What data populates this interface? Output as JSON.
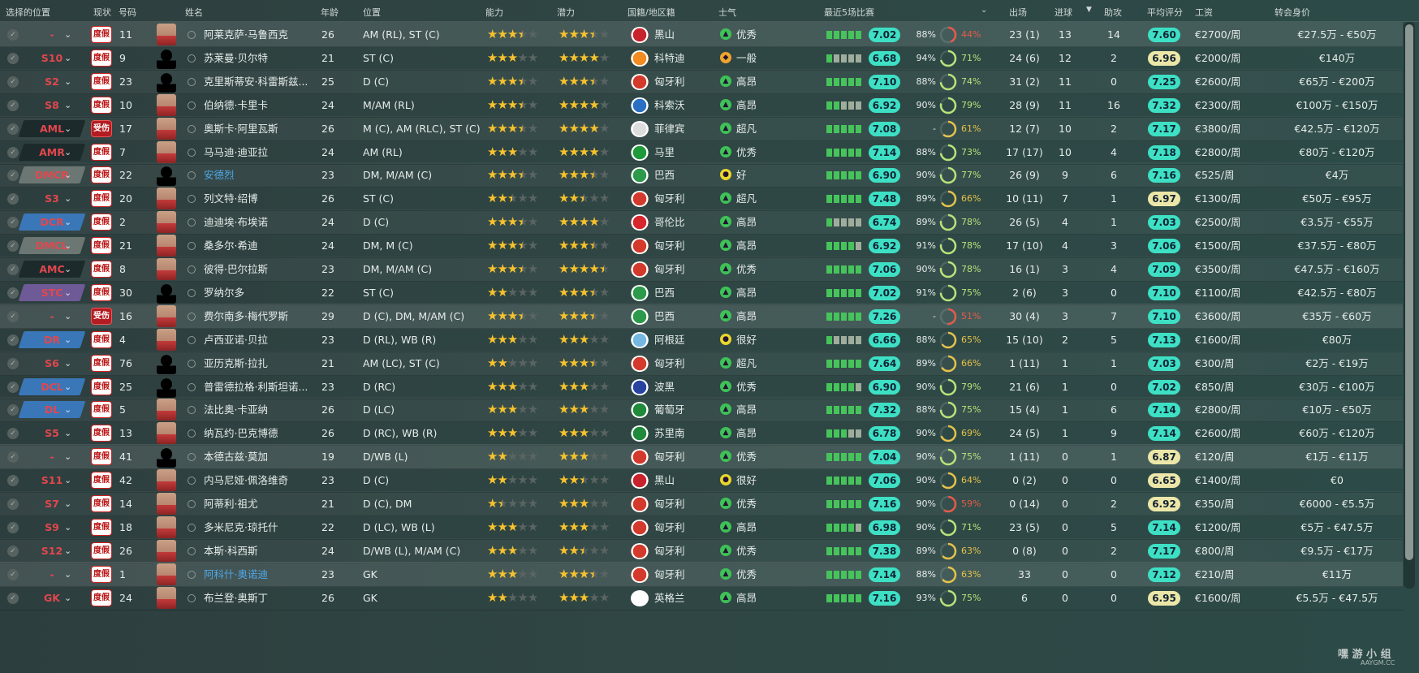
{
  "headers": {
    "select_pos": "选择的位置",
    "status": "现状",
    "number": "号码",
    "name": "姓名",
    "age": "年龄",
    "position": "位置",
    "ability": "能力",
    "potential": "潜力",
    "nationality": "国籍/地区籍",
    "morale": "士气",
    "last5": "最近5场比赛",
    "apps": "出场",
    "goals": "进球",
    "assists": "助攻",
    "avg_rating": "平均评分",
    "wage": "工资",
    "value": "转会身价"
  },
  "colors": {
    "rating_good": "#3ee0c4",
    "rating_ok": "#ece7a8",
    "pos_red": "#e2474d",
    "bar_green": "#46c35b",
    "bar_off": "#a0ad9c",
    "link_blue": "#4ea8e8"
  },
  "players": [
    {
      "pos": "-",
      "pos_style": "none",
      "status": "度假",
      "num": "11",
      "name": "阿莱克萨·马鲁西克",
      "face": "photo",
      "age": "26",
      "position": "AM (RL), ST (C)",
      "ability": 3.5,
      "potential": 3.5,
      "flag": "#c8232c",
      "nation": "黑山",
      "morale": "优秀",
      "mood": "up",
      "form": [
        1,
        1,
        1,
        1,
        1
      ],
      "form_rating": "7.02",
      "fitness": "88%",
      "cond": "44%",
      "cond_val": 0.44,
      "apps": "23 (1)",
      "goals": "13",
      "assists": "14",
      "avg": "7.60",
      "avg_style": "good",
      "wage": "€2700/周",
      "value": "€27.5万 - €50万",
      "row": "hl"
    },
    {
      "pos": "S10",
      "pos_style": "none",
      "status": "度假",
      "num": "9",
      "name": "苏莱曼·贝尔特",
      "face": "sil",
      "age": "21",
      "position": "ST (C)",
      "ability": 3,
      "potential": 4,
      "flag": "#f28b20",
      "nation": "科特迪",
      "morale": "一般",
      "mood": "mid",
      "form": [
        1,
        0,
        0,
        0,
        0
      ],
      "form_rating": "6.68",
      "fitness": "94%",
      "cond": "71%",
      "cond_val": 0.71,
      "apps": "24 (6)",
      "goals": "12",
      "assists": "2",
      "avg": "6.96",
      "avg_style": "ok",
      "wage": "€2000/周",
      "value": "€140万",
      "row": ""
    },
    {
      "pos": "S2",
      "pos_style": "none",
      "status": "度假",
      "num": "23",
      "name": "克里斯蒂安·科雷斯兹...",
      "face": "sil",
      "age": "25",
      "position": "D (C)",
      "ability": 3.5,
      "potential": 3.5,
      "flag": "#d33a2c",
      "nation": "匈牙利",
      "morale": "高昂",
      "mood": "up",
      "form": [
        1,
        1,
        1,
        1,
        1
      ],
      "form_rating": "7.10",
      "fitness": "88%",
      "cond": "74%",
      "cond_val": 0.74,
      "apps": "31 (2)",
      "goals": "11",
      "assists": "0",
      "avg": "7.25",
      "avg_style": "good",
      "wage": "€2600/周",
      "value": "€65万 - €200万",
      "row": "alt"
    },
    {
      "pos": "S8",
      "pos_style": "none",
      "status": "度假",
      "num": "10",
      "name": "伯纳德·卡里卡",
      "face": "photo",
      "age": "24",
      "position": "M/AM (RL)",
      "ability": 3.5,
      "potential": 4,
      "flag": "#2a6fc4",
      "nation": "科索沃",
      "morale": "高昂",
      "mood": "up",
      "form": [
        1,
        1,
        0,
        0,
        0
      ],
      "form_rating": "6.92",
      "fitness": "90%",
      "cond": "79%",
      "cond_val": 0.79,
      "apps": "28 (9)",
      "goals": "11",
      "assists": "16",
      "avg": "7.32",
      "avg_style": "good",
      "wage": "€2300/周",
      "value": "€100万 - €150万",
      "row": ""
    },
    {
      "pos": "AML",
      "pos_style": "dark",
      "status": "受伤",
      "num": "17",
      "name": "奥斯卡·阿里瓦斯",
      "face": "photo",
      "age": "26",
      "position": "M (C), AM (RLC), ST (C)",
      "ability": 3.5,
      "potential": 4,
      "flag": "#dddddd",
      "nation": "菲律宾",
      "morale": "超凡",
      "mood": "up",
      "form": [
        1,
        1,
        1,
        1,
        1
      ],
      "form_rating": "7.08",
      "fitness": "-",
      "cond": "61%",
      "cond_val": 0.61,
      "apps": "12 (7)",
      "goals": "10",
      "assists": "2",
      "avg": "7.17",
      "avg_style": "good",
      "wage": "€3800/周",
      "value": "€42.5万 - €120万",
      "row": "alt"
    },
    {
      "pos": "AMR",
      "pos_style": "dark",
      "status": "度假",
      "num": "7",
      "name": "马马迪·迪亚拉",
      "face": "photo",
      "age": "24",
      "position": "AM (RL)",
      "ability": 3,
      "potential": 4,
      "flag": "#1f9a3a",
      "nation": "马里",
      "morale": "优秀",
      "mood": "up",
      "form": [
        1,
        1,
        1,
        1,
        1
      ],
      "form_rating": "7.14",
      "fitness": "88%",
      "cond": "73%",
      "cond_val": 0.73,
      "apps": "17 (17)",
      "goals": "10",
      "assists": "4",
      "avg": "7.18",
      "avg_style": "good",
      "wage": "€2800/周",
      "value": "€80万 - €120万",
      "row": ""
    },
    {
      "pos": "DMCR",
      "pos_style": "grey",
      "status": "度假",
      "num": "22",
      "name": "安德烈",
      "face": "sil",
      "age": "23",
      "position": "DM, M/AM (C)",
      "ability": 3.5,
      "potential": 3.5,
      "flag": "#2c9a4a",
      "nation": "巴西",
      "morale": "好",
      "mood": "ok",
      "form": [
        1,
        1,
        1,
        1,
        1
      ],
      "form_rating": "6.90",
      "fitness": "90%",
      "cond": "77%",
      "cond_val": 0.77,
      "apps": "26 (9)",
      "goals": "9",
      "assists": "6",
      "avg": "7.16",
      "avg_style": "good",
      "wage": "€525/周",
      "value": "€4万",
      "row": "alt",
      "link": true
    },
    {
      "pos": "S3",
      "pos_style": "none",
      "status": "度假",
      "num": "20",
      "name": "列文特·绍博",
      "face": "photo",
      "age": "26",
      "position": "ST (C)",
      "ability": 2.5,
      "potential": 2.5,
      "flag": "#d33a2c",
      "nation": "匈牙利",
      "morale": "超凡",
      "mood": "up",
      "form": [
        1,
        1,
        1,
        1,
        1
      ],
      "form_rating": "7.48",
      "fitness": "89%",
      "cond": "66%",
      "cond_val": 0.66,
      "apps": "10 (11)",
      "goals": "7",
      "assists": "1",
      "avg": "6.97",
      "avg_style": "ok",
      "wage": "€1300/周",
      "value": "€50万 - €95万",
      "row": ""
    },
    {
      "pos": "DCR",
      "pos_style": "blue",
      "status": "度假",
      "num": "2",
      "name": "迪迪埃·布埃诺",
      "face": "photo",
      "age": "24",
      "position": "D (C)",
      "ability": 3.5,
      "potential": 4,
      "flag": "#d8262e",
      "nation": "哥伦比",
      "morale": "高昂",
      "mood": "up",
      "form": [
        1,
        0,
        0,
        0,
        0
      ],
      "form_rating": "6.74",
      "fitness": "89%",
      "cond": "78%",
      "cond_val": 0.78,
      "apps": "26 (5)",
      "goals": "4",
      "assists": "1",
      "avg": "7.03",
      "avg_style": "good",
      "wage": "€2500/周",
      "value": "€3.5万 - €55万",
      "row": "alt"
    },
    {
      "pos": "DMCL",
      "pos_style": "grey",
      "status": "度假",
      "num": "21",
      "name": "桑多尔·希迪",
      "face": "photo",
      "age": "24",
      "position": "DM, M (C)",
      "ability": 3.5,
      "potential": 3.5,
      "flag": "#d33a2c",
      "nation": "匈牙利",
      "morale": "高昂",
      "mood": "up",
      "form": [
        1,
        1,
        1,
        1,
        0
      ],
      "form_rating": "6.92",
      "fitness": "91%",
      "cond": "78%",
      "cond_val": 0.78,
      "apps": "17 (10)",
      "goals": "4",
      "assists": "3",
      "avg": "7.06",
      "avg_style": "good",
      "wage": "€1500/周",
      "value": "€37.5万 - €80万",
      "row": ""
    },
    {
      "pos": "AMC",
      "pos_style": "dark",
      "status": "度假",
      "num": "8",
      "name": "彼得·巴尔拉斯",
      "face": "photo",
      "age": "23",
      "position": "DM, M/AM (C)",
      "ability": 3.5,
      "potential": 4.5,
      "flag": "#d33a2c",
      "nation": "匈牙利",
      "morale": "优秀",
      "mood": "up",
      "form": [
        1,
        1,
        1,
        1,
        1
      ],
      "form_rating": "7.06",
      "fitness": "90%",
      "cond": "78%",
      "cond_val": 0.78,
      "apps": "16 (1)",
      "goals": "3",
      "assists": "4",
      "avg": "7.09",
      "avg_style": "good",
      "wage": "€3500/周",
      "value": "€47.5万 - €160万",
      "row": "alt"
    },
    {
      "pos": "STC",
      "pos_style": "purple",
      "status": "度假",
      "num": "30",
      "name": "罗纳尔多",
      "face": "sil",
      "age": "22",
      "position": "ST (C)",
      "ability": 2,
      "potential": 3.5,
      "flag": "#2c9a4a",
      "nation": "巴西",
      "morale": "高昂",
      "mood": "up",
      "form": [
        1,
        1,
        1,
        1,
        1
      ],
      "form_rating": "7.02",
      "fitness": "91%",
      "cond": "75%",
      "cond_val": 0.75,
      "apps": "2 (6)",
      "goals": "3",
      "assists": "0",
      "avg": "7.10",
      "avg_style": "good",
      "wage": "€1100/周",
      "value": "€42.5万 - €80万",
      "row": ""
    },
    {
      "pos": "-",
      "pos_style": "none",
      "status": "受伤",
      "num": "16",
      "name": "费尔南多·梅代罗斯",
      "face": "photo",
      "age": "29",
      "position": "D (C), DM, M/AM (C)",
      "ability": 3.5,
      "potential": 3.5,
      "flag": "#2c9a4a",
      "nation": "巴西",
      "morale": "高昂",
      "mood": "up",
      "form": [
        1,
        1,
        1,
        1,
        1
      ],
      "form_rating": "7.26",
      "fitness": "-",
      "cond": "51%",
      "cond_val": 0.51,
      "apps": "30 (4)",
      "goals": "3",
      "assists": "7",
      "avg": "7.10",
      "avg_style": "good",
      "wage": "€3600/周",
      "value": "€35万 - €60万",
      "row": "hl"
    },
    {
      "pos": "DR",
      "pos_style": "blue",
      "status": "度假",
      "num": "4",
      "name": "卢西亚诺·贝拉",
      "face": "photo",
      "age": "23",
      "position": "D (RL), WB (R)",
      "ability": 3,
      "potential": 3,
      "flag": "#74b8e2",
      "nation": "阿根廷",
      "morale": "很好",
      "mood": "ok",
      "form": [
        1,
        0,
        0,
        0,
        0
      ],
      "form_rating": "6.66",
      "fitness": "88%",
      "cond": "65%",
      "cond_val": 0.65,
      "apps": "15 (10)",
      "goals": "2",
      "assists": "5",
      "avg": "7.13",
      "avg_style": "good",
      "wage": "€1600/周",
      "value": "€80万",
      "row": ""
    },
    {
      "pos": "S6",
      "pos_style": "none",
      "status": "度假",
      "num": "76",
      "name": "亚历克斯·拉扎",
      "face": "sil",
      "age": "21",
      "position": "AM (LC), ST (C)",
      "ability": 2,
      "potential": 3.5,
      "flag": "#d33a2c",
      "nation": "匈牙利",
      "morale": "超凡",
      "mood": "up",
      "form": [
        1,
        1,
        1,
        1,
        1
      ],
      "form_rating": "7.64",
      "fitness": "89%",
      "cond": "66%",
      "cond_val": 0.66,
      "apps": "1 (11)",
      "goals": "1",
      "assists": "1",
      "avg": "7.03",
      "avg_style": "good",
      "wage": "€300/周",
      "value": "€2万 - €19万",
      "row": "alt"
    },
    {
      "pos": "DCL",
      "pos_style": "blue",
      "status": "度假",
      "num": "25",
      "name": "普雷德拉格·利斯坦诺...",
      "face": "sil",
      "age": "23",
      "position": "D (RC)",
      "ability": 3,
      "potential": 3,
      "flag": "#2744a0",
      "nation": "波黑",
      "morale": "优秀",
      "mood": "up",
      "form": [
        1,
        1,
        1,
        1,
        0
      ],
      "form_rating": "6.90",
      "fitness": "90%",
      "cond": "79%",
      "cond_val": 0.79,
      "apps": "21 (6)",
      "goals": "1",
      "assists": "0",
      "avg": "7.02",
      "avg_style": "good",
      "wage": "€850/周",
      "value": "€30万 - €100万",
      "row": ""
    },
    {
      "pos": "DL",
      "pos_style": "blue",
      "status": "度假",
      "num": "5",
      "name": "法比奥·卡亚纳",
      "face": "photo",
      "age": "26",
      "position": "D (LC)",
      "ability": 3,
      "potential": 3,
      "flag": "#1f8a3a",
      "nation": "葡萄牙",
      "morale": "高昂",
      "mood": "up",
      "form": [
        1,
        1,
        1,
        1,
        1
      ],
      "form_rating": "7.32",
      "fitness": "88%",
      "cond": "75%",
      "cond_val": 0.75,
      "apps": "15 (4)",
      "goals": "1",
      "assists": "6",
      "avg": "7.14",
      "avg_style": "good",
      "wage": "€2800/周",
      "value": "€10万 - €50万",
      "row": "alt"
    },
    {
      "pos": "S5",
      "pos_style": "none",
      "status": "度假",
      "num": "13",
      "name": "纳瓦约·巴克博德",
      "face": "photo",
      "age": "26",
      "position": "D (RC), WB (R)",
      "ability": 3,
      "potential": 3,
      "flag": "#1f8a3a",
      "nation": "苏里南",
      "morale": "高昂",
      "mood": "up",
      "form": [
        1,
        1,
        1,
        0,
        0
      ],
      "form_rating": "6.78",
      "fitness": "90%",
      "cond": "69%",
      "cond_val": 0.69,
      "apps": "24 (5)",
      "goals": "1",
      "assists": "9",
      "avg": "7.14",
      "avg_style": "good",
      "wage": "€2600/周",
      "value": "€60万 - €120万",
      "row": ""
    },
    {
      "pos": "-",
      "pos_style": "none",
      "status": "度假",
      "num": "41",
      "name": "本德古兹·莫加",
      "face": "sil",
      "age": "19",
      "position": "D/WB (L)",
      "ability": 2,
      "potential": 3,
      "flag": "#d33a2c",
      "nation": "匈牙利",
      "morale": "优秀",
      "mood": "up",
      "form": [
        1,
        1,
        1,
        1,
        1
      ],
      "form_rating": "7.04",
      "fitness": "90%",
      "cond": "75%",
      "cond_val": 0.75,
      "apps": "1 (11)",
      "goals": "0",
      "assists": "1",
      "avg": "6.87",
      "avg_style": "ok",
      "wage": "€120/周",
      "value": "€1万 - €11万",
      "row": "hl"
    },
    {
      "pos": "S11",
      "pos_style": "none",
      "status": "度假",
      "num": "42",
      "name": "内马尼娅·佩洛维奇",
      "face": "photo",
      "age": "23",
      "position": "D (C)",
      "ability": 2,
      "potential": 2.5,
      "flag": "#c8232c",
      "nation": "黑山",
      "morale": "很好",
      "mood": "ok",
      "form": [
        1,
        1,
        1,
        1,
        1
      ],
      "form_rating": "7.06",
      "fitness": "90%",
      "cond": "64%",
      "cond_val": 0.64,
      "apps": "0 (2)",
      "goals": "0",
      "assists": "0",
      "avg": "6.65",
      "avg_style": "ok",
      "wage": "€1400/周",
      "value": "€0",
      "row": ""
    },
    {
      "pos": "S7",
      "pos_style": "none",
      "status": "度假",
      "num": "14",
      "name": "阿蒂利·祖尤",
      "face": "photo",
      "age": "21",
      "position": "D (C), DM",
      "ability": 1.5,
      "potential": 3,
      "flag": "#d33a2c",
      "nation": "匈牙利",
      "morale": "优秀",
      "mood": "up",
      "form": [
        1,
        1,
        1,
        1,
        1
      ],
      "form_rating": "7.16",
      "fitness": "90%",
      "cond": "59%",
      "cond_val": 0.59,
      "apps": "0 (14)",
      "goals": "0",
      "assists": "2",
      "avg": "6.92",
      "avg_style": "ok",
      "wage": "€350/周",
      "value": "€6000 - €5.5万",
      "row": "alt"
    },
    {
      "pos": "S9",
      "pos_style": "none",
      "status": "度假",
      "num": "18",
      "name": "多米尼克·琼托什",
      "face": "photo",
      "age": "22",
      "position": "D (LC), WB (L)",
      "ability": 3,
      "potential": 3,
      "flag": "#d33a2c",
      "nation": "匈牙利",
      "morale": "高昂",
      "mood": "up",
      "form": [
        1,
        1,
        1,
        1,
        0
      ],
      "form_rating": "6.98",
      "fitness": "90%",
      "cond": "71%",
      "cond_val": 0.71,
      "apps": "23 (5)",
      "goals": "0",
      "assists": "5",
      "avg": "7.14",
      "avg_style": "good",
      "wage": "€1200/周",
      "value": "€5万 - €47.5万",
      "row": ""
    },
    {
      "pos": "S12",
      "pos_style": "none",
      "status": "度假",
      "num": "26",
      "name": "本斯·科西斯",
      "face": "photo",
      "age": "24",
      "position": "D/WB (L), M/AM (C)",
      "ability": 3,
      "potential": 2.5,
      "flag": "#d33a2c",
      "nation": "匈牙利",
      "morale": "优秀",
      "mood": "up",
      "form": [
        1,
        1,
        1,
        1,
        1
      ],
      "form_rating": "7.38",
      "fitness": "89%",
      "cond": "63%",
      "cond_val": 0.63,
      "apps": "0 (8)",
      "goals": "0",
      "assists": "2",
      "avg": "7.17",
      "avg_style": "good",
      "wage": "€800/周",
      "value": "€9.5万 - €17万",
      "row": "alt"
    },
    {
      "pos": "-",
      "pos_style": "none",
      "status": "度假",
      "num": "1",
      "name": "阿科什·奥诺迪",
      "face": "photo",
      "age": "23",
      "position": "GK",
      "ability": 3,
      "potential": 3.5,
      "flag": "#d33a2c",
      "nation": "匈牙利",
      "morale": "优秀",
      "mood": "up",
      "form": [
        1,
        1,
        1,
        1,
        1
      ],
      "form_rating": "7.14",
      "fitness": "88%",
      "cond": "63%",
      "cond_val": 0.63,
      "apps": "33",
      "goals": "0",
      "assists": "0",
      "avg": "7.12",
      "avg_style": "good",
      "wage": "€210/周",
      "value": "€11万",
      "row": "hl",
      "link": true
    },
    {
      "pos": "GK",
      "pos_style": "none",
      "status": "度假",
      "num": "24",
      "name": "布兰登·奥斯丁",
      "face": "photo",
      "age": "26",
      "position": "GK",
      "ability": 2,
      "potential": 3,
      "flag": "#ffffff",
      "nation": "英格兰",
      "morale": "高昂",
      "mood": "up",
      "form": [
        1,
        1,
        1,
        1,
        1
      ],
      "form_rating": "7.16",
      "fitness": "93%",
      "cond": "75%",
      "cond_val": 0.75,
      "apps": "6",
      "goals": "0",
      "assists": "0",
      "avg": "6.95",
      "avg_style": "ok",
      "wage": "€1600/周",
      "value": "€5.5万 - €47.5万",
      "row": ""
    }
  ],
  "watermark": {
    "line1": "嘿 游 小 组",
    "line2": "AAYGM.CC"
  }
}
